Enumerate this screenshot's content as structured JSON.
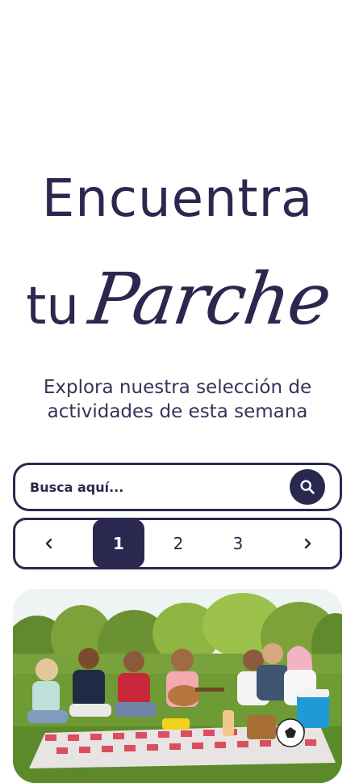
{
  "hero": {
    "line1": "Encuentra",
    "line2_prefix": "tu",
    "line2_script": "Parche"
  },
  "subtitle": {
    "line1": "Explora nuestra selección de",
    "line2": "actividades de esta semana"
  },
  "search": {
    "placeholder": "Busca aquí...",
    "icon": "search-icon"
  },
  "pagination": {
    "prev_icon": "chevron-left-icon",
    "pages": [
      "1",
      "2",
      "3"
    ],
    "active_page": "1",
    "next_icon": "chevron-right-icon"
  },
  "featured_image": {
    "subject": "group-picnic-photo"
  },
  "colors": {
    "primary": "#2b2850",
    "background": "#ffffff"
  }
}
